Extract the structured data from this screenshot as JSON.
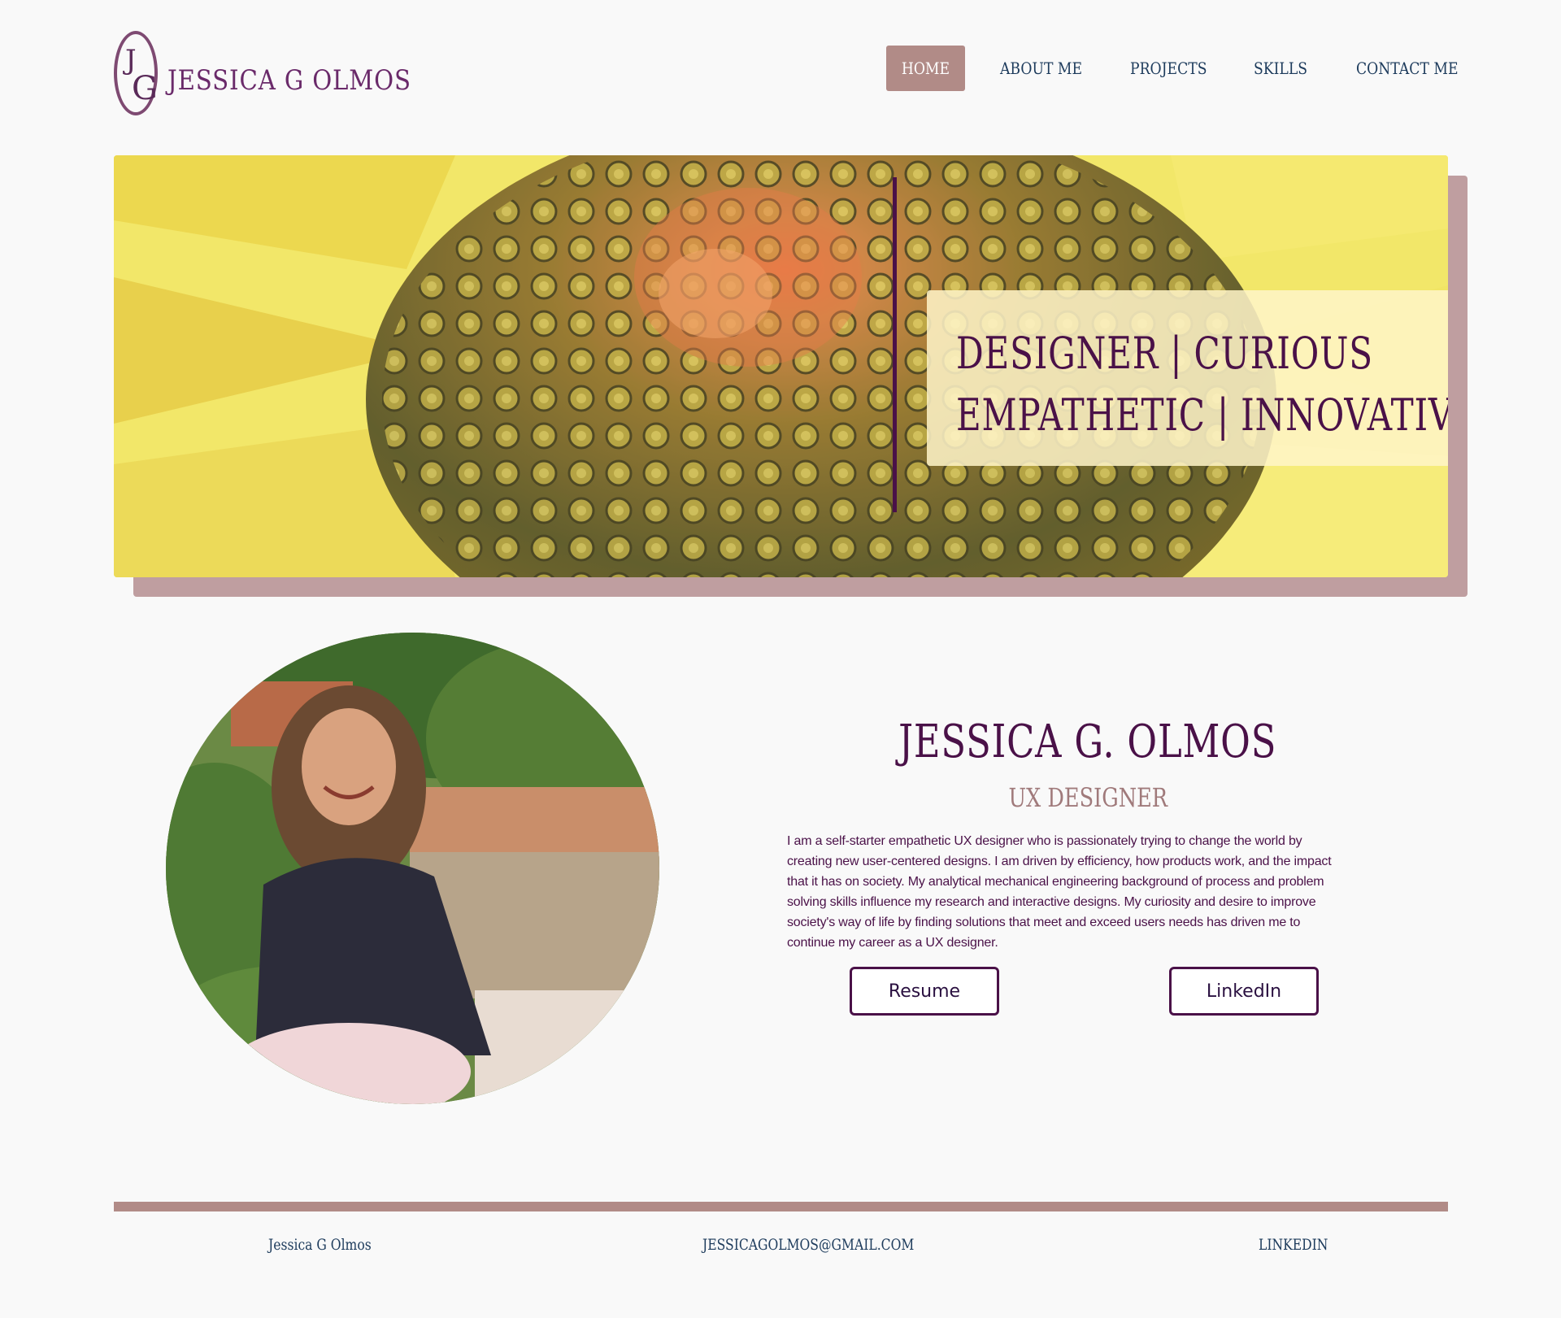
{
  "brand": {
    "monogram_j": "J",
    "monogram_g": "G",
    "name": "JESSICA G OLMOS"
  },
  "nav": {
    "items": [
      {
        "label": "HOME",
        "active": true
      },
      {
        "label": "ABOUT ME",
        "active": false
      },
      {
        "label": "PROJECTS",
        "active": false
      },
      {
        "label": "SKILLS",
        "active": false
      },
      {
        "label": "CONTACT ME",
        "active": false
      }
    ]
  },
  "hero": {
    "tagline_line1": "DESIGNER | CURIOUS",
    "tagline_line2": "EMPATHETIC | INNOVATIVE"
  },
  "profile": {
    "name": "JESSICA G. OLMOS",
    "title": "UX DESIGNER",
    "bio": "I am a self-starter empathetic UX designer who is passionately trying to change the world by creating new user-centered designs.  I am driven by efficiency, how products work, and the impact that it has on society.    My analytical mechanical engineering background of process and problem solving skills influence my research and interactive designs. My curiosity and desire to improve society's way of life by finding solutions that meet and exceed users needs has driven me to continue my career as a UX designer.",
    "resume_label": "Resume",
    "linkedin_label": "LinkedIn"
  },
  "footer": {
    "name": "Jessica G Olmos",
    "email": "JESSICAGOLMOS@GMAIL.COM",
    "linkedin": "LINKEDIN"
  },
  "colors": {
    "accent": "#b18b87",
    "primary_text": "#4a1148",
    "nav_text": "#1d3b5c",
    "background": "#f9f9f9"
  }
}
